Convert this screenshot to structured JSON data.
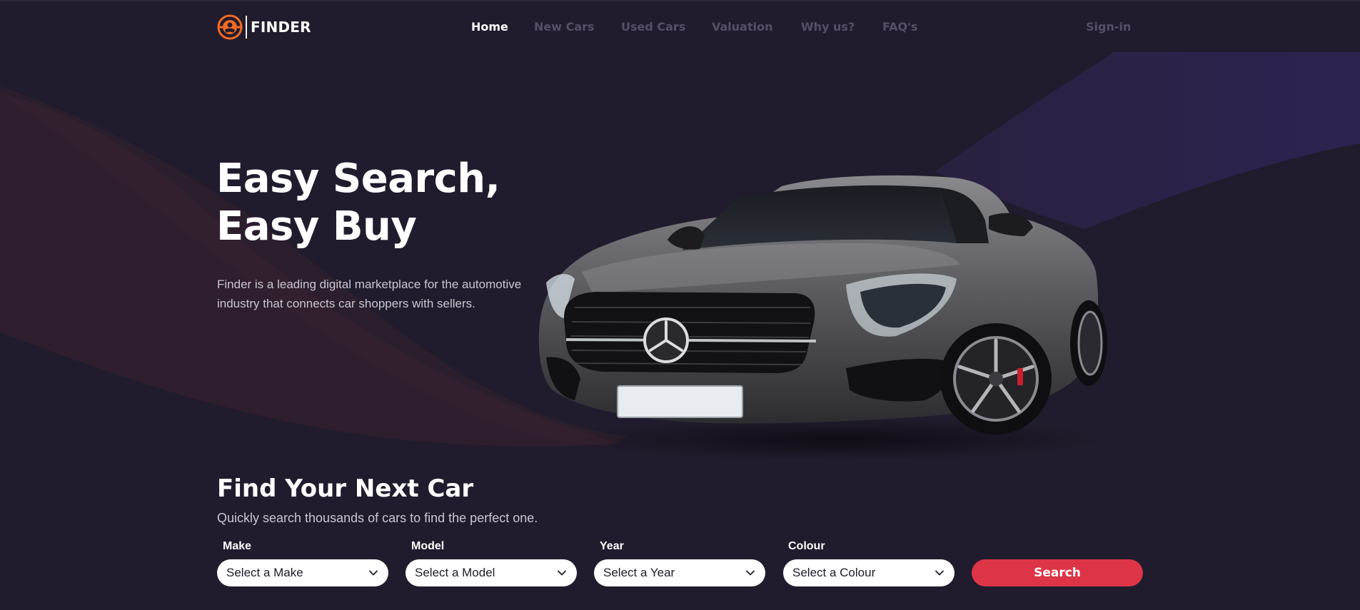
{
  "brand": {
    "name": "FINDER",
    "logo_icon": "steering-wheel-icon",
    "accent": "#f26b21"
  },
  "nav": {
    "links": [
      {
        "label": "Home",
        "active": true
      },
      {
        "label": "New Cars",
        "active": false
      },
      {
        "label": "Used Cars",
        "active": false
      },
      {
        "label": "Valuation",
        "active": false
      },
      {
        "label": "Why us?",
        "active": false
      },
      {
        "label": "FAQ's",
        "active": false
      }
    ],
    "signin_label": "Sign-in"
  },
  "hero": {
    "title_line1": "Easy Search,",
    "title_line2": "Easy Buy",
    "description": "Finder is a leading digital marketplace for the automotive industry that connects car shoppers with sellers."
  },
  "finder": {
    "title": "Find Your Next Car",
    "subtitle": "Quickly search thousands of cars to find the perfect one.",
    "fields": [
      {
        "label": "Make",
        "placeholder": "Select a Make"
      },
      {
        "label": "Model",
        "placeholder": "Select a Model"
      },
      {
        "label": "Year",
        "placeholder": "Select a Year"
      },
      {
        "label": "Colour",
        "placeholder": "Select a Colour"
      }
    ],
    "search_label": "Search"
  },
  "colors": {
    "background": "#211c2d",
    "nav_inactive": "#545066",
    "search_button": "#dd3547",
    "hero_swoosh_left": "#3a2130",
    "hero_swoosh_right": "#2e2248"
  }
}
